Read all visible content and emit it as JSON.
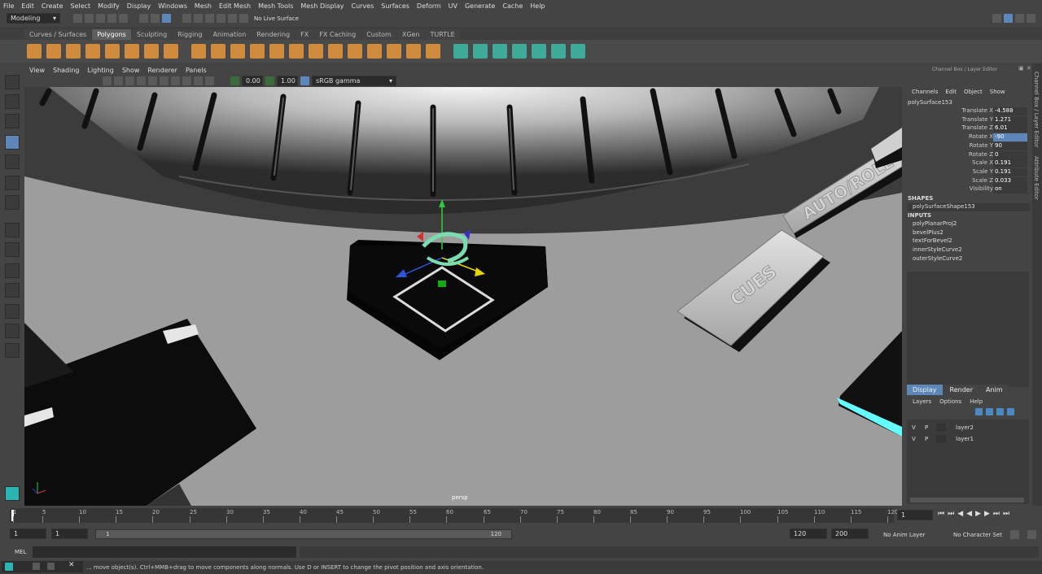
{
  "menubar": {
    "items": [
      "File",
      "Edit",
      "Create",
      "Select",
      "Modify",
      "Display",
      "Windows",
      "Mesh",
      "Edit Mesh",
      "Mesh Tools",
      "Mesh Display",
      "Curves",
      "Surfaces",
      "Deform",
      "UV",
      "Generate",
      "Cache",
      "Help"
    ]
  },
  "status": {
    "mode": "Modeling",
    "live_surface": "No Live Surface"
  },
  "shelf": {
    "tabs": [
      "Curves / Surfaces",
      "Polygons",
      "Sculpting",
      "Rigging",
      "Animation",
      "Rendering",
      "FX",
      "FX Caching",
      "Custom",
      "XGen",
      "TURTLE"
    ],
    "active": "Polygons"
  },
  "viewport": {
    "menus": [
      "View",
      "Shading",
      "Lighting",
      "Show",
      "Renderer",
      "Panels"
    ],
    "exposure": "0.00",
    "gamma": "1.00",
    "colorspace": "sRGB gamma",
    "camera": "persp",
    "labels": {
      "auto_roll": "AUTO/ROLL",
      "cues": "CUES"
    }
  },
  "channelbox": {
    "title": "Channel Box / Layer Editor",
    "menus": [
      "Channels",
      "Edit",
      "Object",
      "Show"
    ],
    "object": "polySurface153",
    "attrs": [
      {
        "name": "Translate X",
        "value": "-4.588"
      },
      {
        "name": "Translate Y",
        "value": "1.271"
      },
      {
        "name": "Translate Z",
        "value": "6.01"
      },
      {
        "name": "Rotate X",
        "value": "-90"
      },
      {
        "name": "Rotate Y",
        "value": "90"
      },
      {
        "name": "Rotate Z",
        "value": "0"
      },
      {
        "name": "Scale X",
        "value": "0.191"
      },
      {
        "name": "Scale Y",
        "value": "0.191"
      },
      {
        "name": "Scale Z",
        "value": "0.033"
      },
      {
        "name": "Visibility",
        "value": "on"
      }
    ],
    "shapes_header": "SHAPES",
    "shape": "polySurfaceShape153",
    "inputs_header": "INPUTS",
    "inputs": [
      "polyPlanarProj2",
      "bevelPlus2",
      "textForBevel2",
      "innerStyleCurve2",
      "outerStyleCurve2"
    ]
  },
  "layers": {
    "tabs": [
      "Display",
      "Render",
      "Anim"
    ],
    "menus": [
      "Layers",
      "Options",
      "Help"
    ],
    "rows": [
      {
        "v": "V",
        "p": "P",
        "name": "layer2"
      },
      {
        "v": "V",
        "p": "P",
        "name": "layer1"
      }
    ]
  },
  "side_tabs": [
    "Channel Box / Layer Editor",
    "Attribute Editor"
  ],
  "timeline": {
    "ticks": [
      "1",
      "5",
      "10",
      "15",
      "20",
      "25",
      "30",
      "35",
      "40",
      "45",
      "50",
      "55",
      "60",
      "65",
      "70",
      "75",
      "80",
      "85",
      "90",
      "95",
      "100",
      "105",
      "110",
      "115",
      "120"
    ],
    "current_frame": "1"
  },
  "range": {
    "start": "1",
    "anim_start": "1",
    "slider_start": "1",
    "slider_end": "120",
    "end": "120",
    "anim_end": "200",
    "anim_layer": "No Anim Layer",
    "char_set": "No Character Set"
  },
  "cmd": {
    "label": "MEL"
  },
  "help": "... move object(s). Ctrl+MMB+drag to move components along normals. Use D or INSERT to change the pivot position and axis orientation.",
  "colors": {
    "accent": "#5d87b8",
    "shelf_orange": "#d08b3c",
    "manip_green": "#33cc33",
    "cyan_edge": "#6ff"
  }
}
